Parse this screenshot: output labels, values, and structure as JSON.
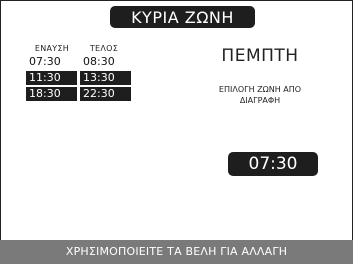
{
  "header": {
    "title": "ΚΥΡΙΑ ΖΩΝΗ"
  },
  "schedule": {
    "columns": [
      "ΕΝΑΥΣΗ",
      "ΤΕΛΟΣ"
    ],
    "rows": [
      {
        "on": "07:30",
        "off": "08:30",
        "highlighted": false
      },
      {
        "on": "11:30",
        "off": "13:30",
        "highlighted": true
      },
      {
        "on": "18:30",
        "off": "22:30",
        "highlighted": true
      }
    ]
  },
  "day": "ΠΕΜΠΤΗ",
  "hint": {
    "line1": "ΕΠΙΛΟΓΗ ΖΩΝΗ ΑΠΟ",
    "line2": "ΔΙΑΓΡΑΦΗ"
  },
  "selected_time": "07:30",
  "footer": {
    "text": "ΧΡΗΣΙΜΟΠΟΙΕΙΤΕ ΤΑ ΒΕΛΗ ΓΙΑ ΑΛΛΑΓΗ"
  },
  "colors": {
    "dark": "#1e1e1e",
    "footer_bg": "#7a7a7a",
    "text": "#222222"
  }
}
